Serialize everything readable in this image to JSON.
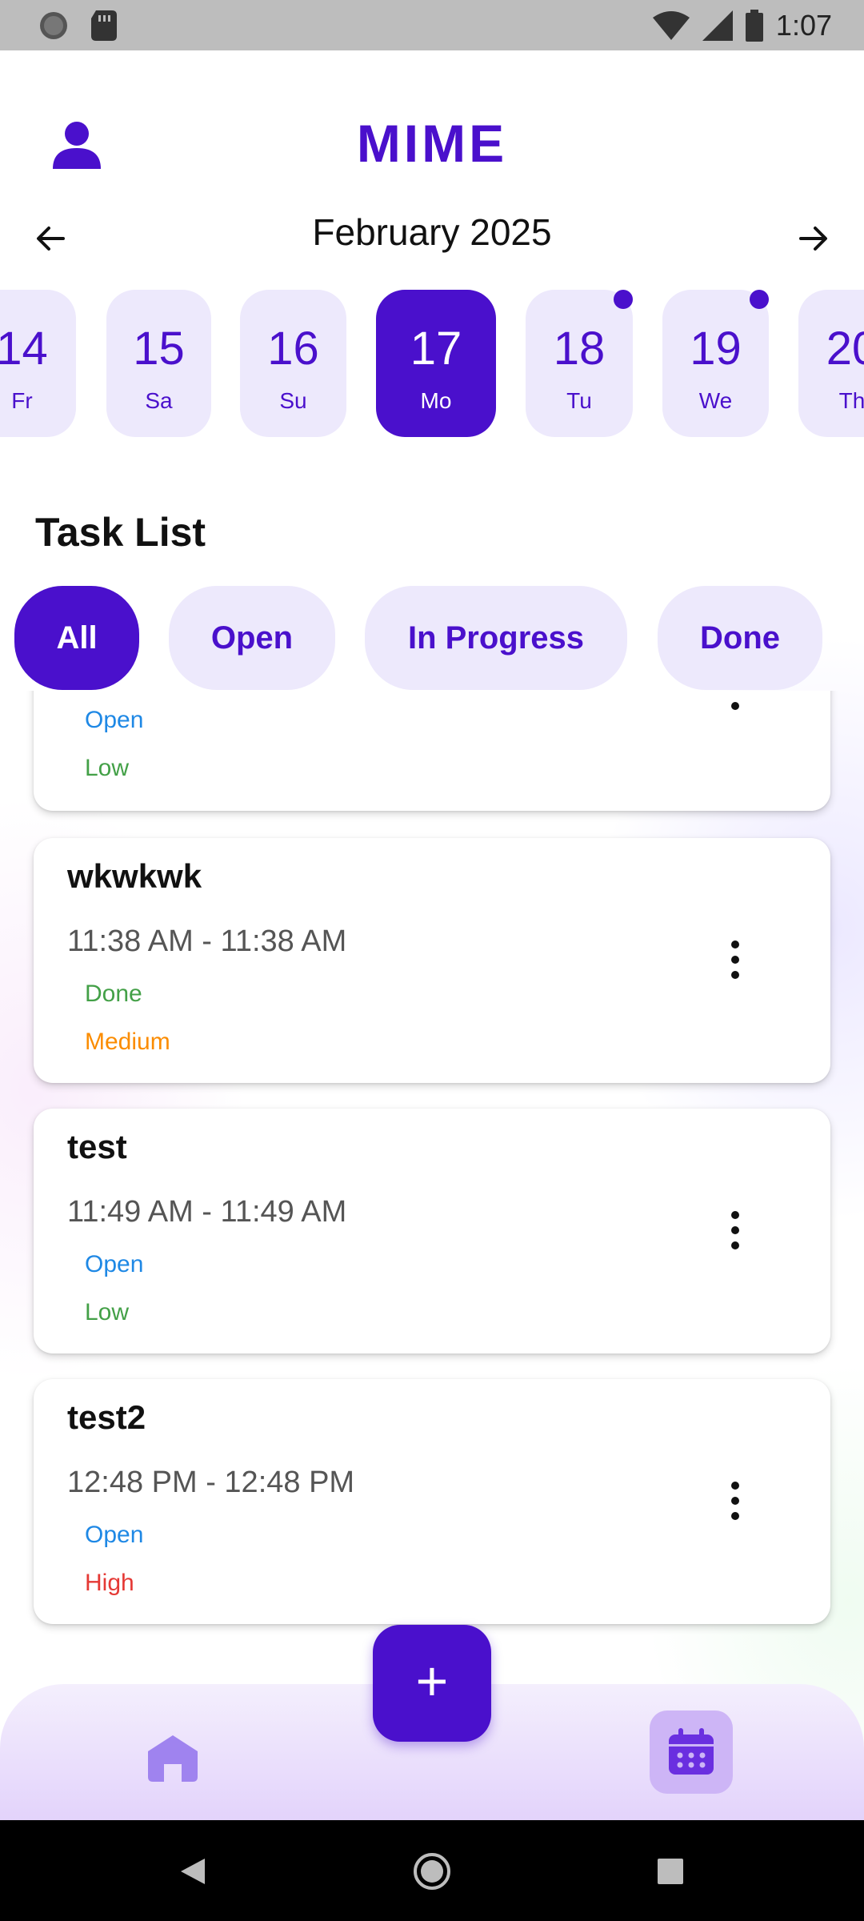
{
  "status_bar": {
    "time": "1:07",
    "icons": [
      "circle-app-icon",
      "sim-card-icon",
      "wifi-icon",
      "cell-signal-icon",
      "battery-icon"
    ]
  },
  "header": {
    "app_name": "MIME",
    "profile_icon": "person-icon"
  },
  "calendar": {
    "month_label": "February 2025",
    "prev_icon": "arrow-left-icon",
    "next_icon": "arrow-right-icon",
    "days": [
      {
        "num": "14",
        "name": "Fr",
        "selected": false,
        "has_tasks": false
      },
      {
        "num": "15",
        "name": "Sa",
        "selected": false,
        "has_tasks": false
      },
      {
        "num": "16",
        "name": "Su",
        "selected": false,
        "has_tasks": false
      },
      {
        "num": "17",
        "name": "Mo",
        "selected": true,
        "has_tasks": false
      },
      {
        "num": "18",
        "name": "Tu",
        "selected": false,
        "has_tasks": true
      },
      {
        "num": "19",
        "name": "We",
        "selected": false,
        "has_tasks": true
      },
      {
        "num": "20",
        "name": "Th",
        "selected": false,
        "has_tasks": false
      }
    ]
  },
  "task_section": {
    "title": "Task List",
    "filters": [
      {
        "label": "All",
        "active": true
      },
      {
        "label": "Open",
        "active": false
      },
      {
        "label": "In Progress",
        "active": false
      },
      {
        "label": "Done",
        "active": false
      }
    ]
  },
  "tasks": [
    {
      "title": "",
      "time": "",
      "status": "Open",
      "priority": "Low"
    },
    {
      "title": "wkwkwk",
      "time": "11:38 AM - 11:38 AM",
      "status": "Done",
      "priority": "Medium"
    },
    {
      "title": "test",
      "time": "11:49 AM - 11:49 AM",
      "status": "Open",
      "priority": "Low"
    },
    {
      "title": "test2",
      "time": "12:48 PM - 12:48 PM",
      "status": "Open",
      "priority": "High"
    }
  ],
  "colors": {
    "primary": "#4a10cc",
    "chip_bg": "#ede9fc",
    "status_open": "#1e88e5",
    "status_done": "#43a047",
    "priority_low": "#43a047",
    "priority_medium": "#fb8c00",
    "priority_high": "#e53935"
  },
  "bottom_nav": {
    "home_icon": "home-icon",
    "calendar_icon": "calendar-icon",
    "fab_label": "+"
  },
  "system_nav": {
    "back_icon": "back-triangle-icon",
    "home_icon": "home-circle-icon",
    "recents_icon": "recents-square-icon"
  }
}
